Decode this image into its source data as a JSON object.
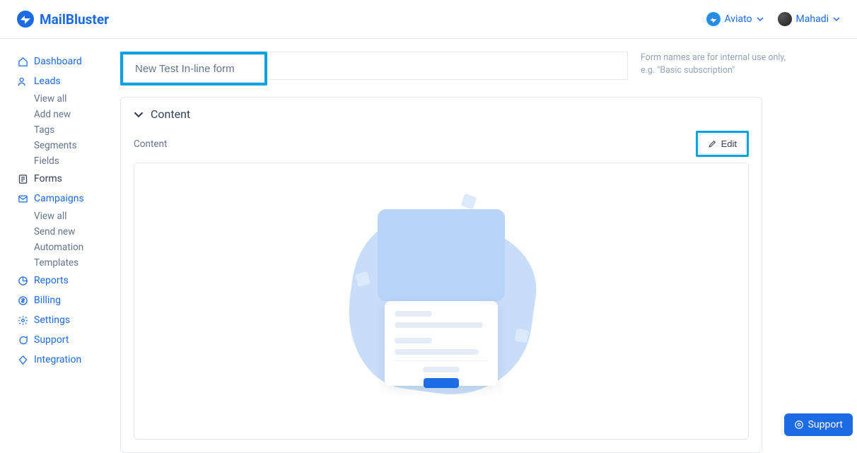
{
  "brand": {
    "name": "MailBluster"
  },
  "header": {
    "workspace": "Aviato",
    "user": "Mahadi"
  },
  "sidebar": {
    "dashboard": "Dashboard",
    "leads": {
      "label": "Leads",
      "items": [
        "View all",
        "Add new",
        "Tags",
        "Segments",
        "Fields"
      ]
    },
    "forms": "Forms",
    "campaigns": {
      "label": "Campaigns",
      "items": [
        "View all",
        "Send new",
        "Automation",
        "Templates"
      ]
    },
    "reports": "Reports",
    "billing": "Billing",
    "settings": "Settings",
    "support": "Support",
    "integration": "Integration"
  },
  "main": {
    "form_name": "New Test In-line form",
    "hint_line1": "Form names are for internal use only,",
    "hint_line2": "e.g. \"Basic subscription\"",
    "section_title": "Content",
    "content_label": "Content",
    "edit_label": "Edit"
  },
  "fab": {
    "support": "Support"
  }
}
